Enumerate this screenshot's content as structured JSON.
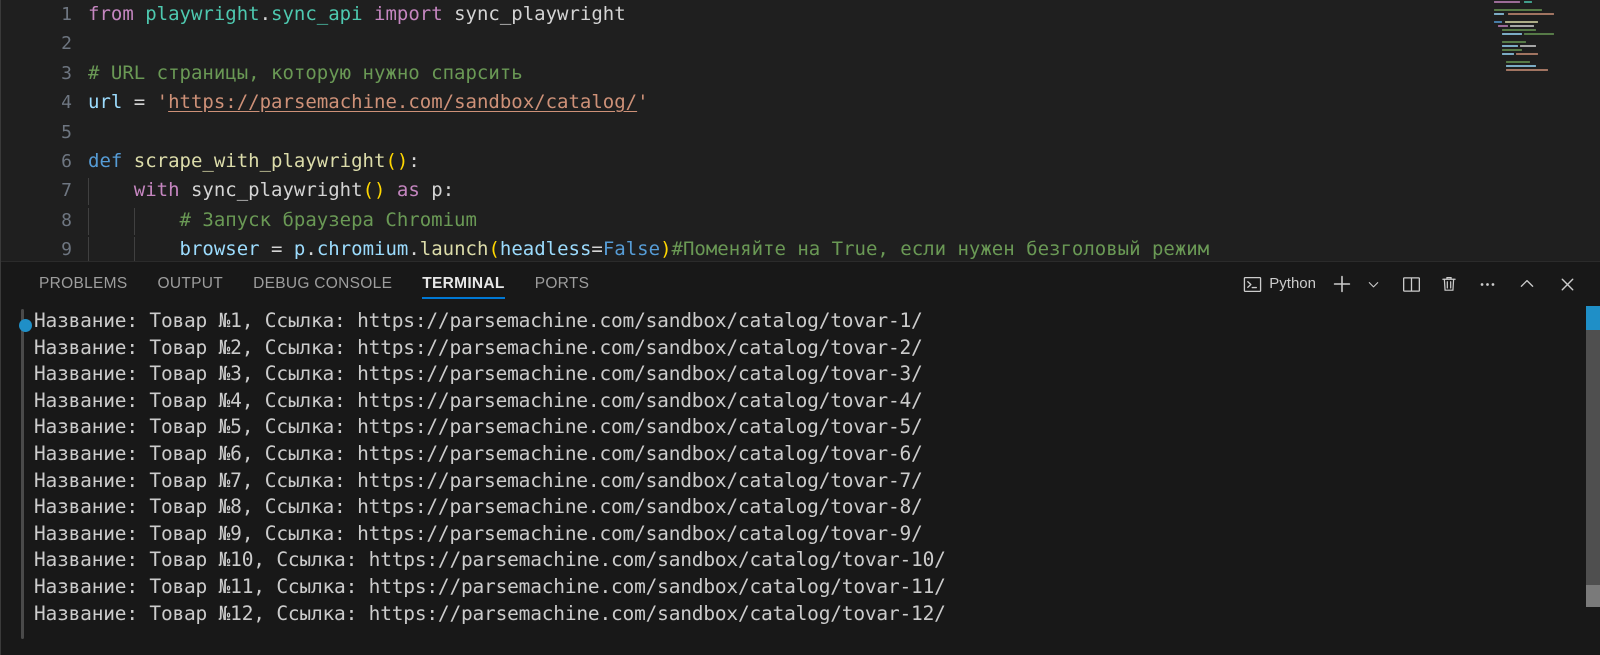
{
  "editor": {
    "lines": [
      {
        "num": "1",
        "indent_guides": 0,
        "tokens": [
          {
            "t": "from ",
            "c": "t-kw"
          },
          {
            "t": "playwright",
            "c": "t-mod"
          },
          {
            "t": ".",
            "c": "t-plain"
          },
          {
            "t": "sync_api",
            "c": "t-mod"
          },
          {
            "t": " ",
            "c": "t-plain"
          },
          {
            "t": "import",
            "c": "t-kw"
          },
          {
            "t": " sync_playwright",
            "c": "t-plain"
          }
        ]
      },
      {
        "num": "2",
        "indent_guides": 0,
        "tokens": []
      },
      {
        "num": "3",
        "indent_guides": 0,
        "tokens": [
          {
            "t": "# URL страницы, которую нужно спарсить",
            "c": "t-com"
          }
        ]
      },
      {
        "num": "4",
        "indent_guides": 0,
        "tokens": [
          {
            "t": "url",
            "c": "t-var"
          },
          {
            "t": " = ",
            "c": "t-op"
          },
          {
            "t": "'",
            "c": "t-str"
          },
          {
            "t": "https://parsemachine.com/sandbox/catalog/",
            "c": "t-link"
          },
          {
            "t": "'",
            "c": "t-str"
          }
        ]
      },
      {
        "num": "5",
        "indent_guides": 0,
        "tokens": []
      },
      {
        "num": "6",
        "indent_guides": 0,
        "tokens": [
          {
            "t": "def ",
            "c": "t-def"
          },
          {
            "t": "scrape_with_playwright",
            "c": "t-fn"
          },
          {
            "t": "(",
            "c": "t-paren1"
          },
          {
            "t": ")",
            "c": "t-paren1"
          },
          {
            "t": ":",
            "c": "t-plain"
          }
        ]
      },
      {
        "num": "7",
        "indent_guides": 1,
        "tokens": [
          {
            "t": "    ",
            "c": "t-plain"
          },
          {
            "t": "with ",
            "c": "t-kw"
          },
          {
            "t": "sync_playwright",
            "c": "t-plain"
          },
          {
            "t": "(",
            "c": "t-paren1"
          },
          {
            "t": ")",
            "c": "t-paren1"
          },
          {
            "t": " ",
            "c": "t-plain"
          },
          {
            "t": "as",
            "c": "t-kw"
          },
          {
            "t": " p:",
            "c": "t-plain"
          }
        ]
      },
      {
        "num": "8",
        "indent_guides": 2,
        "tokens": [
          {
            "t": "        ",
            "c": "t-plain"
          },
          {
            "t": "# Запуск браузера Chromium",
            "c": "t-com"
          }
        ]
      },
      {
        "num": "9",
        "indent_guides": 2,
        "tokens": [
          {
            "t": "        ",
            "c": "t-plain"
          },
          {
            "t": "browser",
            "c": "t-var"
          },
          {
            "t": " = ",
            "c": "t-op"
          },
          {
            "t": "p",
            "c": "t-var"
          },
          {
            "t": ".",
            "c": "t-plain"
          },
          {
            "t": "chromium",
            "c": "t-var"
          },
          {
            "t": ".",
            "c": "t-plain"
          },
          {
            "t": "launch",
            "c": "t-fn"
          },
          {
            "t": "(",
            "c": "t-paren1"
          },
          {
            "t": "headless",
            "c": "t-var"
          },
          {
            "t": "=",
            "c": "t-op"
          },
          {
            "t": "False",
            "c": "t-const"
          },
          {
            "t": ")",
            "c": "t-paren1"
          },
          {
            "t": "#Поменяйте на True, если нужен безголовый режим",
            "c": "t-com"
          }
        ]
      }
    ],
    "minimap": {
      "name": "code-minimap"
    }
  },
  "panel": {
    "tabs": [
      {
        "label": "PROBLEMS",
        "active": false,
        "name": "tab-problems"
      },
      {
        "label": "OUTPUT",
        "active": false,
        "name": "tab-output"
      },
      {
        "label": "DEBUG CONSOLE",
        "active": false,
        "name": "tab-debug-console"
      },
      {
        "label": "TERMINAL",
        "active": true,
        "name": "tab-terminal"
      },
      {
        "label": "PORTS",
        "active": false,
        "name": "tab-ports"
      }
    ],
    "terminal_name": "Python",
    "actions": [
      {
        "name": "new-terminal-icon",
        "label": "+"
      },
      {
        "name": "chevron-down-icon",
        "label": "v"
      },
      {
        "name": "split-terminal-icon",
        "label": "split"
      },
      {
        "name": "trash-icon",
        "label": "kill"
      },
      {
        "name": "more-actions-icon",
        "label": "..."
      },
      {
        "name": "maximize-panel-icon",
        "label": "^"
      },
      {
        "name": "close-panel-icon",
        "label": "x"
      }
    ],
    "accent_color": "#0078d4"
  },
  "terminal": {
    "lines": [
      "Название: Товар №1, Ссылка: https://parsemachine.com/sandbox/catalog/tovar-1/",
      "Название: Товар №2, Ссылка: https://parsemachine.com/sandbox/catalog/tovar-2/",
      "Название: Товар №3, Ссылка: https://parsemachine.com/sandbox/catalog/tovar-3/",
      "Название: Товар №4, Ссылка: https://parsemachine.com/sandbox/catalog/tovar-4/",
      "Название: Товар №5, Ссылка: https://parsemachine.com/sandbox/catalog/tovar-5/",
      "Название: Товар №6, Ссылка: https://parsemachine.com/sandbox/catalog/tovar-6/",
      "Название: Товар №7, Ссылка: https://parsemachine.com/sandbox/catalog/tovar-7/",
      "Название: Товар №8, Ссылка: https://parsemachine.com/sandbox/catalog/tovar-8/",
      "Название: Товар №9, Ссылка: https://parsemachine.com/sandbox/catalog/tovar-9/",
      "Название: Товар №10, Ссылка: https://parsemachine.com/sandbox/catalog/tovar-10/",
      "Название: Товар №11, Ссылка: https://parsemachine.com/sandbox/catalog/tovar-11/",
      "Название: Товар №12, Ссылка: https://parsemachine.com/sandbox/catalog/tovar-12/"
    ],
    "command_marker_color": "#1f8fc7",
    "text_color": "#cccccc"
  }
}
